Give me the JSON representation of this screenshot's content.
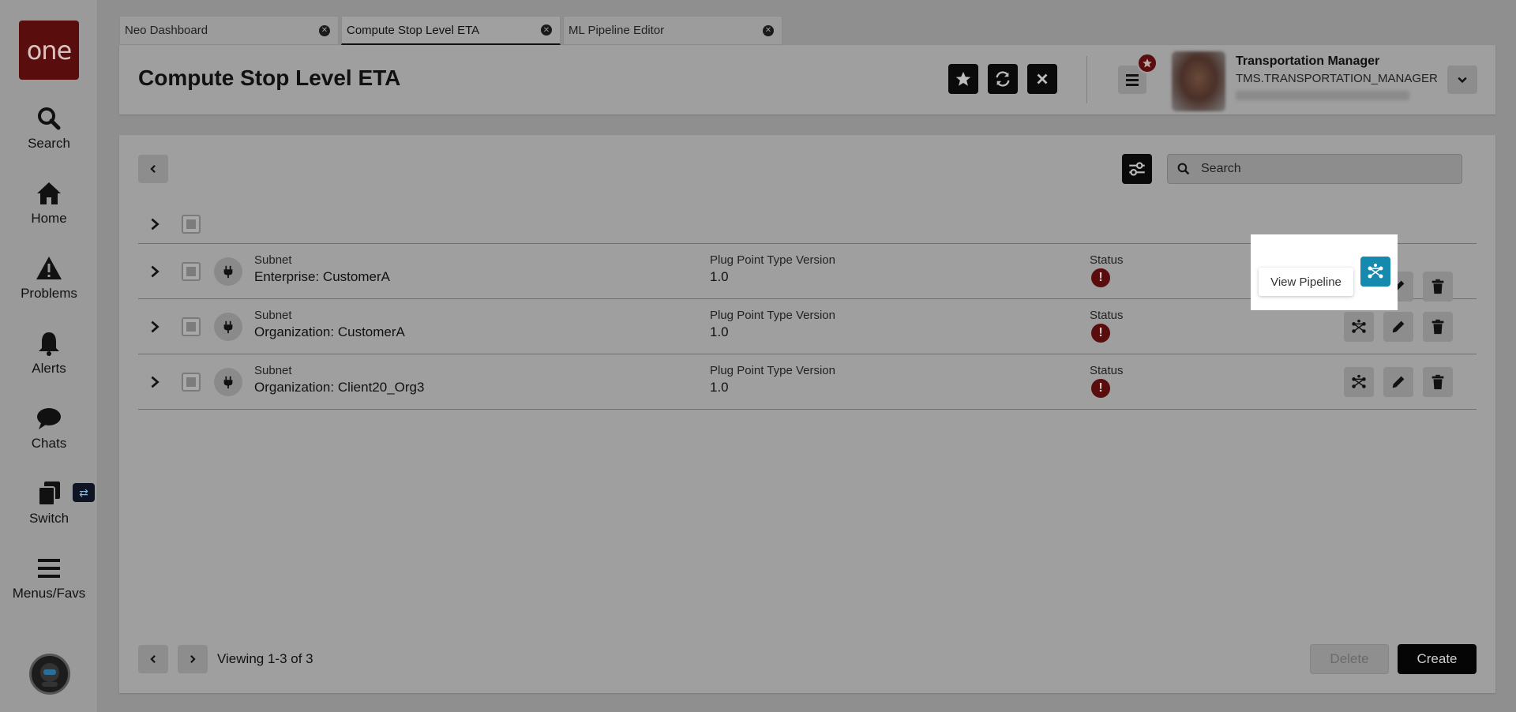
{
  "sidebar": {
    "logo": "one",
    "items": [
      {
        "label": "Search",
        "icon": "search-icon"
      },
      {
        "label": "Home",
        "icon": "home-icon"
      },
      {
        "label": "Problems",
        "icon": "warning-icon"
      },
      {
        "label": "Alerts",
        "icon": "bell-icon"
      },
      {
        "label": "Chats",
        "icon": "chat-icon"
      },
      {
        "label": "Switch",
        "icon": "switch-icon"
      },
      {
        "label": "Menus/Favs",
        "icon": "menu-icon"
      }
    ]
  },
  "tabs": [
    {
      "label": "Neo Dashboard",
      "active": false
    },
    {
      "label": "Compute Stop Level ETA",
      "active": true
    },
    {
      "label": "ML Pipeline Editor",
      "active": false
    }
  ],
  "header": {
    "title": "Compute Stop Level ETA",
    "user_name": "Transportation Manager",
    "user_role": "TMS.TRANSPORTATION_MANAGER"
  },
  "search": {
    "placeholder": "Search"
  },
  "rows": [
    {
      "subnet_label": "Subnet",
      "subnet": "Enterprise: CustomerA",
      "version_label": "Plug Point Type Version",
      "version": "1.0",
      "status_label": "Status",
      "status": "error"
    },
    {
      "subnet_label": "Subnet",
      "subnet": "Organization: CustomerA",
      "version_label": "Plug Point Type Version",
      "version": "1.0",
      "status_label": "Status",
      "status": "error"
    },
    {
      "subnet_label": "Subnet",
      "subnet": "Organization: Client20_Org3",
      "version_label": "Plug Point Type Version",
      "version": "1.0",
      "status_label": "Status",
      "status": "error"
    }
  ],
  "tooltip": "View Pipeline",
  "footer": {
    "viewing": "Viewing 1-3 of 3",
    "delete_label": "Delete",
    "create_label": "Create"
  },
  "colors": {
    "accent": "#0f7fa0",
    "brand": "#5a0d0d",
    "overlay": "#8f8f8f"
  }
}
